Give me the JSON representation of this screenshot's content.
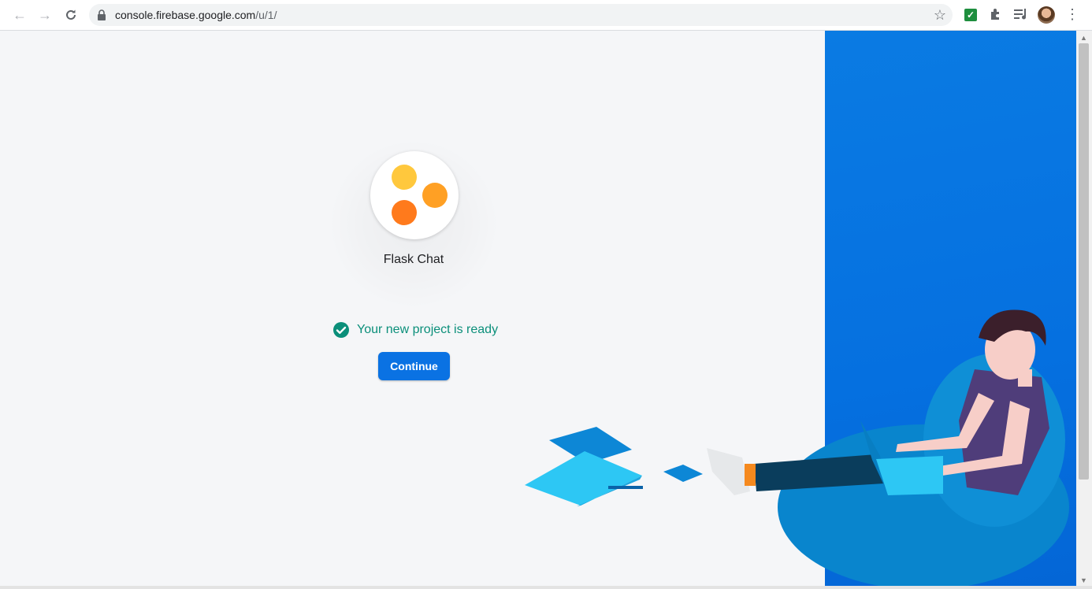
{
  "browser": {
    "url_host": "console.firebase.google.com",
    "url_path": "/u/1/"
  },
  "project": {
    "name": "Flask Chat",
    "logo_colors": [
      "#ffc83d",
      "#ffa024",
      "#ff7a1c"
    ]
  },
  "status": {
    "message": "Your new project is ready",
    "color": "#0b8f7a"
  },
  "actions": {
    "continue_label": "Continue"
  },
  "colors": {
    "accent": "#0a72e3",
    "panel_blue": "#0a7be3"
  },
  "icons": [
    "back-arrow-icon",
    "forward-arrow-icon",
    "reload-icon",
    "lock-icon",
    "star-icon",
    "extension-check-icon",
    "puzzle-icon",
    "media-control-icon",
    "avatar",
    "kebab-menu-icon",
    "check-circle-icon"
  ]
}
